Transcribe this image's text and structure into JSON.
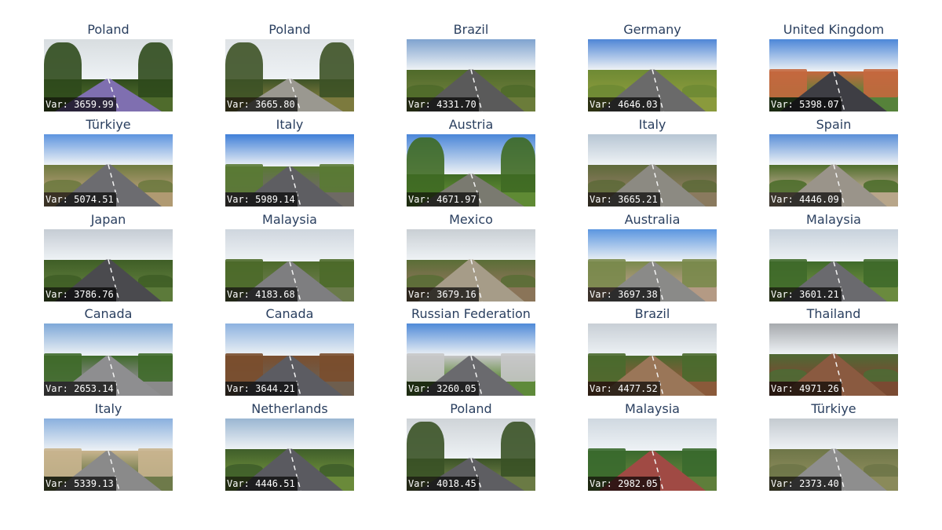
{
  "var_prefix": "Var: ",
  "tiles": [
    {
      "title": "Poland",
      "var": "3659.99",
      "sky": "#d8dde0",
      "ground": "#4f6b2c",
      "veg": "#2f4a1c",
      "road": "#7f6fb0",
      "scene": "forest"
    },
    {
      "title": "Poland",
      "var": "3665.80",
      "sky": "#dfe3e6",
      "ground": "#7c7a3e",
      "veg": "#3d5226",
      "road": "#9a9890",
      "scene": "forest"
    },
    {
      "title": "Brazil",
      "var": "4331.70",
      "sky": "#7fa3cf",
      "ground": "#6b7c3a",
      "veg": "#4f6a2a",
      "road": "#5a5a5a",
      "scene": "open"
    },
    {
      "title": "Germany",
      "var": "4646.03",
      "sky": "#4f86d6",
      "ground": "#8a9a3c",
      "veg": "#6e8a34",
      "road": "#6a6a6a",
      "scene": "open"
    },
    {
      "title": "United Kingdom",
      "var": "5398.07",
      "sky": "#4c87d8",
      "ground": "#56823a",
      "veg": "#c4683e",
      "road": "#3e3e44",
      "scene": "town"
    },
    {
      "title": "Türkiye",
      "var": "5074.51",
      "sky": "#5d94df",
      "ground": "#b09a72",
      "veg": "#6e7a40",
      "road": "#6c6c70",
      "scene": "open"
    },
    {
      "title": "Italy",
      "var": "5989.14",
      "sky": "#3f7fd8",
      "ground": "#6e6a64",
      "veg": "#5a7a34",
      "road": "#5e5e62",
      "scene": "town"
    },
    {
      "title": "Austria",
      "var": "4671.97",
      "sky": "#4a86d8",
      "ground": "#5f8a34",
      "veg": "#3f6a24",
      "road": "#7a7a70",
      "scene": "forest"
    },
    {
      "title": "Italy",
      "var": "3665.21",
      "sky": "#b7c6d4",
      "ground": "#8a7a5e",
      "veg": "#5e6a3a",
      "road": "#8c8a82",
      "scene": "open"
    },
    {
      "title": "Spain",
      "var": "4446.09",
      "sky": "#5a8fd8",
      "ground": "#b8a68a",
      "veg": "#4e6e2c",
      "road": "#9a948a",
      "scene": "open"
    },
    {
      "title": "Japan",
      "var": "3786.76",
      "sky": "#c5ccd4",
      "ground": "#5c7a3a",
      "veg": "#3f5e26",
      "road": "#4a4a4e",
      "scene": "open"
    },
    {
      "title": "Malaysia",
      "var": "4183.68",
      "sky": "#cfd6de",
      "ground": "#6a7a4a",
      "veg": "#4c6a2a",
      "road": "#7e7e80",
      "scene": "town"
    },
    {
      "title": "Mexico",
      "var": "3679.16",
      "sky": "#c9cfd4",
      "ground": "#8a7458",
      "veg": "#5a6e36",
      "road": "#a69c88",
      "scene": "open"
    },
    {
      "title": "Australia",
      "var": "3697.38",
      "sky": "#5b96e0",
      "ground": "#b49a84",
      "veg": "#7a8a4c",
      "road": "#8a8a88",
      "scene": "town"
    },
    {
      "title": "Malaysia",
      "var": "3601.21",
      "sky": "#c8d2dc",
      "ground": "#6a8a3e",
      "veg": "#3f6a2a",
      "road": "#6a6a6e",
      "scene": "town"
    },
    {
      "title": "Canada",
      "var": "2653.14",
      "sky": "#7ea8d8",
      "ground": "#8a8a8a",
      "veg": "#3f6a2a",
      "road": "#8e8e90",
      "scene": "town"
    },
    {
      "title": "Canada",
      "var": "3644.21",
      "sky": "#8db2e0",
      "ground": "#6e5e4e",
      "veg": "#7a4e2e",
      "road": "#5c5c62",
      "scene": "town"
    },
    {
      "title": "Russian Federation",
      "var": "3260.05",
      "sky": "#4f8ad8",
      "ground": "#5f8a3a",
      "veg": "#c6c6c8",
      "road": "#6a6a6e",
      "scene": "town"
    },
    {
      "title": "Brazil",
      "var": "4477.52",
      "sky": "#c8cfd6",
      "ground": "#8a5a3a",
      "veg": "#4a6a2e",
      "road": "#9a7658",
      "scene": "town"
    },
    {
      "title": "Thailand",
      "var": "4971.26",
      "sky": "#a6a9ad",
      "ground": "#7a4a32",
      "veg": "#4e6a34",
      "road": "#8a5a40",
      "scene": "open"
    },
    {
      "title": "Italy",
      "var": "5339.13",
      "sky": "#8ab0de",
      "ground": "#6e7a4a",
      "veg": "#c8b48e",
      "road": "#8a8a8a",
      "scene": "town"
    },
    {
      "title": "Netherlands",
      "var": "4446.51",
      "sky": "#9ab6d2",
      "ground": "#6a8a3a",
      "veg": "#3f5e2a",
      "road": "#5a5a60",
      "scene": "open"
    },
    {
      "title": "Poland",
      "var": "4018.45",
      "sky": "#cfd4d8",
      "ground": "#6a7a44",
      "veg": "#3a5226",
      "road": "#5e5e62",
      "scene": "forest"
    },
    {
      "title": "Malaysia",
      "var": "2982.05",
      "sky": "#cfd8e0",
      "ground": "#5e7e3a",
      "veg": "#3a6a2e",
      "road": "#a04a44",
      "scene": "town"
    },
    {
      "title": "Türkiye",
      "var": "2373.40",
      "sky": "#c4cad0",
      "ground": "#8a8a5a",
      "veg": "#6e7648",
      "road": "#8e8e8e",
      "scene": "open"
    }
  ]
}
